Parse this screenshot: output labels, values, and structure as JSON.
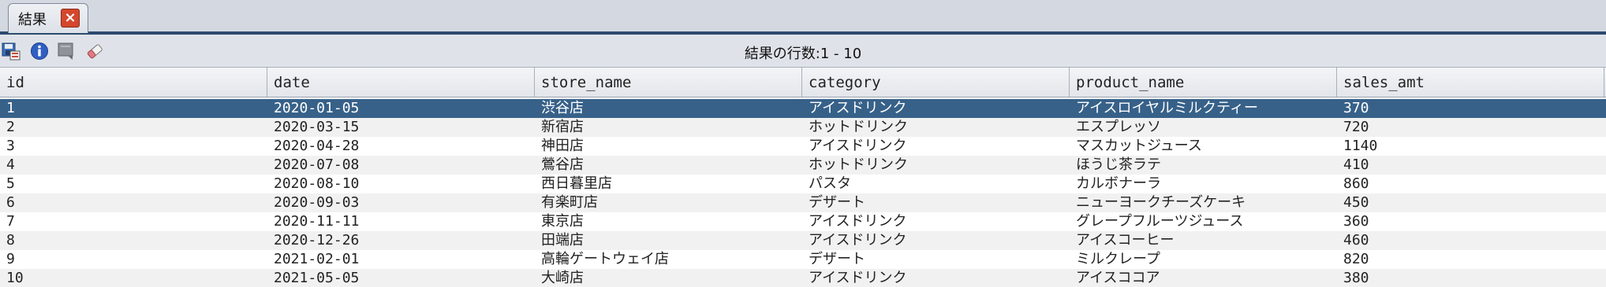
{
  "tab": {
    "label": "結果"
  },
  "toolbar": {
    "result_count": "結果の行数:1 - 10"
  },
  "columns": [
    "id",
    "date",
    "store_name",
    "category",
    "product_name",
    "sales_amt"
  ],
  "rows": [
    [
      "1",
      "2020-01-05",
      "渋谷店",
      "アイスドリンク",
      "アイスロイヤルミルクティー",
      "370"
    ],
    [
      "2",
      "2020-03-15",
      "新宿店",
      "ホットドリンク",
      "エスプレッソ",
      "720"
    ],
    [
      "3",
      "2020-04-28",
      "神田店",
      "アイスドリンク",
      "マスカットジュース",
      "1140"
    ],
    [
      "4",
      "2020-07-08",
      "鶯谷店",
      "ホットドリンク",
      "ほうじ茶ラテ",
      "410"
    ],
    [
      "5",
      "2020-08-10",
      "西日暮里店",
      "パスタ",
      "カルボナーラ",
      "860"
    ],
    [
      "6",
      "2020-09-03",
      "有楽町店",
      "デザート",
      "ニューヨークチーズケーキ",
      "450"
    ],
    [
      "7",
      "2020-11-11",
      "東京店",
      "アイスドリンク",
      "グレープフルーツジュース",
      "360"
    ],
    [
      "8",
      "2020-12-26",
      "田端店",
      "アイスドリンク",
      "アイスコーヒー",
      "460"
    ],
    [
      "9",
      "2021-02-01",
      "高輪ゲートウェイ店",
      "デザート",
      "ミルクレープ",
      "820"
    ],
    [
      "10",
      "2021-05-05",
      "大崎店",
      "アイスドリンク",
      "アイスココア",
      "380"
    ]
  ],
  "selected_row": 0,
  "colors": {
    "selected": "#376189",
    "tab_underline": "#2c4a6e"
  }
}
